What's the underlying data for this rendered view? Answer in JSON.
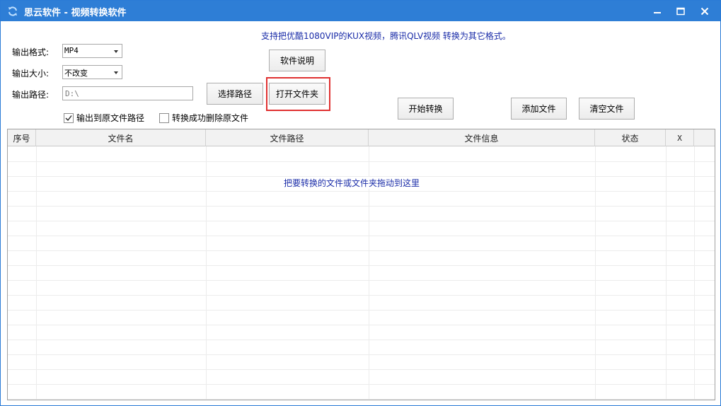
{
  "window": {
    "title": "思云软件 - 视频转换软件",
    "app_icon": "refresh-icon",
    "controls": {
      "minimize": "minimize-icon",
      "maximize": "maximize-icon",
      "close": "close-icon"
    },
    "accent_color": "#2e7ed6"
  },
  "banner": "支持把优酷1080VIP的KUX视频，腾讯QLV视频 转换为其它格式。",
  "form": {
    "format_label": "输出格式:",
    "format_value": "MP4",
    "size_label": "输出大小:",
    "size_value": "不改变",
    "path_label": "输出路径:",
    "path_value": "D:\\"
  },
  "buttons": {
    "software_info": "软件说明",
    "choose_path": "选择路径",
    "open_folder": "打开文件夹",
    "start_convert": "开始转换",
    "add_files": "添加文件",
    "clear_files": "清空文件"
  },
  "checkboxes": {
    "output_to_source": {
      "label": "输出到原文件路径",
      "checked": true
    },
    "delete_after": {
      "label": "转换成功删除原文件",
      "checked": false
    }
  },
  "table": {
    "columns": [
      "序号",
      "文件名",
      "文件路径",
      "文件信息",
      "状态",
      "X"
    ],
    "rows": [],
    "empty_hint": "把要转换的文件或文件夹拖动到这里"
  },
  "highlight_color": "#e03131"
}
